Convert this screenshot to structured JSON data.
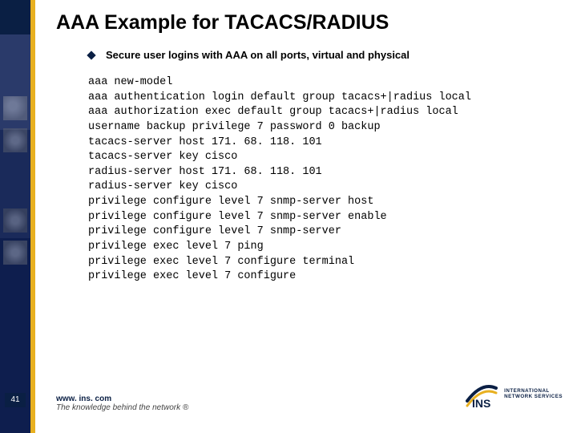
{
  "slide": {
    "title": "AAA Example for TACACS/RADIUS",
    "bullet": "Secure user logins with AAA on all ports, virtual and physical",
    "code_lines": [
      "aaa new-model",
      "aaa authentication login default group tacacs+|radius local",
      "aaa authorization exec default group tacacs+|radius local",
      "username backup privilege 7 password 0 backup",
      "tacacs-server host 171. 68. 118. 101",
      "tacacs-server key cisco",
      "radius-server host 171. 68. 118. 101",
      "radius-server key cisco",
      "privilege configure level 7 snmp-server host",
      "privilege configure level 7 snmp-server enable",
      "privilege configure level 7 snmp-server",
      "privilege exec level 7 ping",
      "privilege exec level 7 configure terminal",
      "privilege exec level 7 configure"
    ],
    "page_number": "41"
  },
  "footer": {
    "url": "www. ins. com",
    "tagline": "The knowledge behind the network ®"
  },
  "logo": {
    "short": "INS",
    "line1": "INTERNATIONAL",
    "line2": "NETWORK SERVICES"
  },
  "colors": {
    "brand_blue": "#0a1f44",
    "accent_gold": "#e8b020"
  }
}
